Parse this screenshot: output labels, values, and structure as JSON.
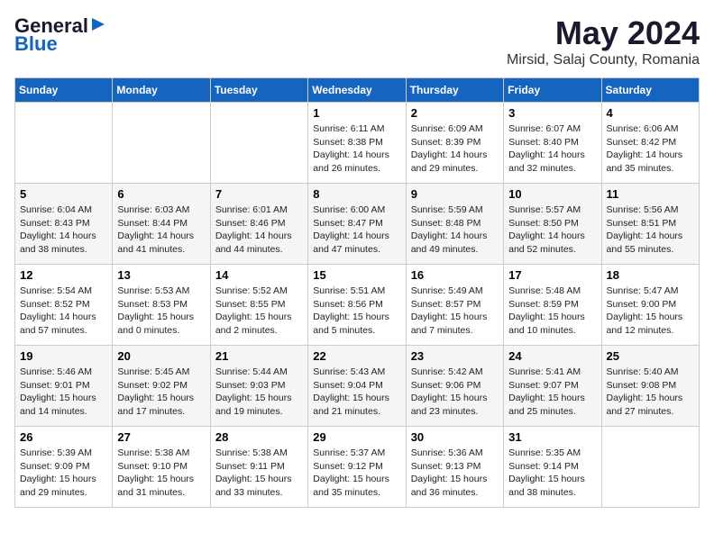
{
  "logo": {
    "line1": "General",
    "line2": "Blue",
    "arrow": "▶"
  },
  "title": "May 2024",
  "subtitle": "Mirsid, Salaj County, Romania",
  "headers": [
    "Sunday",
    "Monday",
    "Tuesday",
    "Wednesday",
    "Thursday",
    "Friday",
    "Saturday"
  ],
  "weeks": [
    [
      {
        "day": "",
        "info": ""
      },
      {
        "day": "",
        "info": ""
      },
      {
        "day": "",
        "info": ""
      },
      {
        "day": "1",
        "info": "Sunrise: 6:11 AM\nSunset: 8:38 PM\nDaylight: 14 hours\nand 26 minutes."
      },
      {
        "day": "2",
        "info": "Sunrise: 6:09 AM\nSunset: 8:39 PM\nDaylight: 14 hours\nand 29 minutes."
      },
      {
        "day": "3",
        "info": "Sunrise: 6:07 AM\nSunset: 8:40 PM\nDaylight: 14 hours\nand 32 minutes."
      },
      {
        "day": "4",
        "info": "Sunrise: 6:06 AM\nSunset: 8:42 PM\nDaylight: 14 hours\nand 35 minutes."
      }
    ],
    [
      {
        "day": "5",
        "info": "Sunrise: 6:04 AM\nSunset: 8:43 PM\nDaylight: 14 hours\nand 38 minutes."
      },
      {
        "day": "6",
        "info": "Sunrise: 6:03 AM\nSunset: 8:44 PM\nDaylight: 14 hours\nand 41 minutes."
      },
      {
        "day": "7",
        "info": "Sunrise: 6:01 AM\nSunset: 8:46 PM\nDaylight: 14 hours\nand 44 minutes."
      },
      {
        "day": "8",
        "info": "Sunrise: 6:00 AM\nSunset: 8:47 PM\nDaylight: 14 hours\nand 47 minutes."
      },
      {
        "day": "9",
        "info": "Sunrise: 5:59 AM\nSunset: 8:48 PM\nDaylight: 14 hours\nand 49 minutes."
      },
      {
        "day": "10",
        "info": "Sunrise: 5:57 AM\nSunset: 8:50 PM\nDaylight: 14 hours\nand 52 minutes."
      },
      {
        "day": "11",
        "info": "Sunrise: 5:56 AM\nSunset: 8:51 PM\nDaylight: 14 hours\nand 55 minutes."
      }
    ],
    [
      {
        "day": "12",
        "info": "Sunrise: 5:54 AM\nSunset: 8:52 PM\nDaylight: 14 hours\nand 57 minutes."
      },
      {
        "day": "13",
        "info": "Sunrise: 5:53 AM\nSunset: 8:53 PM\nDaylight: 15 hours\nand 0 minutes."
      },
      {
        "day": "14",
        "info": "Sunrise: 5:52 AM\nSunset: 8:55 PM\nDaylight: 15 hours\nand 2 minutes."
      },
      {
        "day": "15",
        "info": "Sunrise: 5:51 AM\nSunset: 8:56 PM\nDaylight: 15 hours\nand 5 minutes."
      },
      {
        "day": "16",
        "info": "Sunrise: 5:49 AM\nSunset: 8:57 PM\nDaylight: 15 hours\nand 7 minutes."
      },
      {
        "day": "17",
        "info": "Sunrise: 5:48 AM\nSunset: 8:59 PM\nDaylight: 15 hours\nand 10 minutes."
      },
      {
        "day": "18",
        "info": "Sunrise: 5:47 AM\nSunset: 9:00 PM\nDaylight: 15 hours\nand 12 minutes."
      }
    ],
    [
      {
        "day": "19",
        "info": "Sunrise: 5:46 AM\nSunset: 9:01 PM\nDaylight: 15 hours\nand 14 minutes."
      },
      {
        "day": "20",
        "info": "Sunrise: 5:45 AM\nSunset: 9:02 PM\nDaylight: 15 hours\nand 17 minutes."
      },
      {
        "day": "21",
        "info": "Sunrise: 5:44 AM\nSunset: 9:03 PM\nDaylight: 15 hours\nand 19 minutes."
      },
      {
        "day": "22",
        "info": "Sunrise: 5:43 AM\nSunset: 9:04 PM\nDaylight: 15 hours\nand 21 minutes."
      },
      {
        "day": "23",
        "info": "Sunrise: 5:42 AM\nSunset: 9:06 PM\nDaylight: 15 hours\nand 23 minutes."
      },
      {
        "day": "24",
        "info": "Sunrise: 5:41 AM\nSunset: 9:07 PM\nDaylight: 15 hours\nand 25 minutes."
      },
      {
        "day": "25",
        "info": "Sunrise: 5:40 AM\nSunset: 9:08 PM\nDaylight: 15 hours\nand 27 minutes."
      }
    ],
    [
      {
        "day": "26",
        "info": "Sunrise: 5:39 AM\nSunset: 9:09 PM\nDaylight: 15 hours\nand 29 minutes."
      },
      {
        "day": "27",
        "info": "Sunrise: 5:38 AM\nSunset: 9:10 PM\nDaylight: 15 hours\nand 31 minutes."
      },
      {
        "day": "28",
        "info": "Sunrise: 5:38 AM\nSunset: 9:11 PM\nDaylight: 15 hours\nand 33 minutes."
      },
      {
        "day": "29",
        "info": "Sunrise: 5:37 AM\nSunset: 9:12 PM\nDaylight: 15 hours\nand 35 minutes."
      },
      {
        "day": "30",
        "info": "Sunrise: 5:36 AM\nSunset: 9:13 PM\nDaylight: 15 hours\nand 36 minutes."
      },
      {
        "day": "31",
        "info": "Sunrise: 5:35 AM\nSunset: 9:14 PM\nDaylight: 15 hours\nand 38 minutes."
      },
      {
        "day": "",
        "info": ""
      }
    ]
  ]
}
